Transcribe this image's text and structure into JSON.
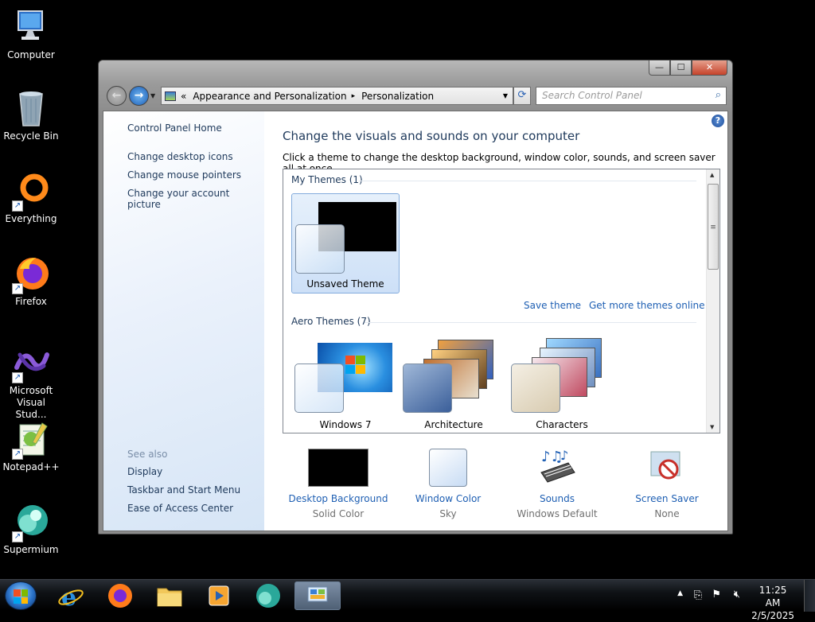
{
  "desktop": {
    "icons": [
      {
        "label": "Computer",
        "icon": "computer-icon"
      },
      {
        "label": "Recycle Bin",
        "icon": "recycle-bin-icon"
      },
      {
        "label": "Everything",
        "icon": "everything-icon"
      },
      {
        "label": "Firefox",
        "icon": "firefox-icon"
      },
      {
        "label": "Microsoft Visual Stud...",
        "icon": "visual-studio-icon"
      },
      {
        "label": "Notepad++",
        "icon": "notepad-plus-plus-icon"
      },
      {
        "label": "Supermium",
        "icon": "supermium-icon"
      }
    ]
  },
  "window": {
    "caption": {
      "minimize": "—",
      "maximize": "☐",
      "close": "✕"
    },
    "address": {
      "prefix": "«",
      "crumb1": "Appearance and Personalization",
      "separator": "▸",
      "crumb2": "Personalization"
    },
    "search": {
      "placeholder": "Search Control Panel"
    },
    "left_pane": {
      "home": "Control Panel Home",
      "links": [
        "Change desktop icons",
        "Change mouse pointers",
        "Change your account picture"
      ],
      "see_also": "See also",
      "see_also_links": [
        "Display",
        "Taskbar and Start Menu",
        "Ease of Access Center"
      ]
    },
    "main": {
      "title": "Change the visuals and sounds on your computer",
      "subtitle": "Click a theme to change the desktop background, window color, sounds, and screen saver all at once.",
      "my_themes_header": "My Themes (1)",
      "my_themes": [
        {
          "name": "Unsaved Theme",
          "selected": true
        }
      ],
      "save_theme": "Save theme",
      "get_more": "Get more themes online",
      "aero_header": "Aero Themes (7)",
      "aero_themes": [
        {
          "name": "Windows 7"
        },
        {
          "name": "Architecture"
        },
        {
          "name": "Characters"
        }
      ]
    },
    "bottom_bar": [
      {
        "label": "Desktop Background",
        "value": "Solid Color"
      },
      {
        "label": "Window Color",
        "value": "Sky"
      },
      {
        "label": "Sounds",
        "value": "Windows Default"
      },
      {
        "label": "Screen Saver",
        "value": "None"
      }
    ]
  },
  "taskbar": {
    "pinned": [
      "internet-explorer-icon",
      "firefox-icon",
      "file-explorer-icon",
      "media-player-icon",
      "supermium-icon",
      "control-panel-icon"
    ],
    "active": "control-panel-icon",
    "clock": {
      "time": "11:25 AM",
      "date": "2/5/2025"
    },
    "tray_icons": [
      "show-hidden-icons-arrow",
      "network-icon",
      "action-center-flag-icon",
      "volume-muted-icon"
    ]
  },
  "colors": {
    "link": "#1e5fb3",
    "heading": "#1e395b",
    "desktop": "#000000"
  }
}
